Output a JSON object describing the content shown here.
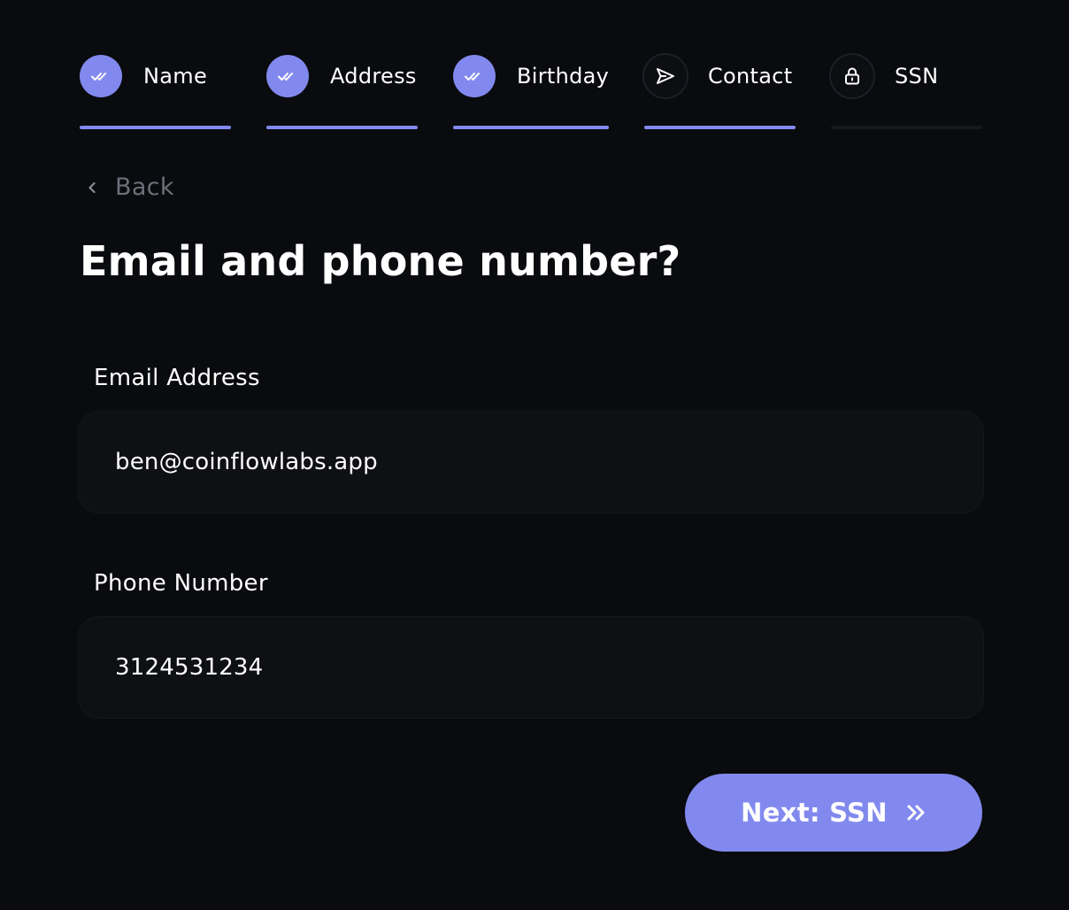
{
  "colors": {
    "background": "#0a0b0e",
    "accent": "#8289ee",
    "input_bg": "#0f1014",
    "muted_text": "#6d7079",
    "inactive_bar": "#16181e"
  },
  "stepper": {
    "steps": [
      {
        "label": "Name",
        "status": "completed",
        "icon": "double-check-icon"
      },
      {
        "label": "Address",
        "status": "completed",
        "icon": "double-check-icon"
      },
      {
        "label": "Birthday",
        "status": "completed",
        "icon": "double-check-icon"
      },
      {
        "label": "Contact",
        "status": "current",
        "icon": "send-icon"
      },
      {
        "label": "SSN",
        "status": "locked",
        "icon": "lock-icon"
      }
    ]
  },
  "back": {
    "label": "Back",
    "icon": "chevron-left-icon"
  },
  "title": "Email and phone number?",
  "form": {
    "email": {
      "label": "Email Address",
      "value": "ben@coinflowlabs.app"
    },
    "phone": {
      "label": "Phone Number",
      "value": "3124531234"
    }
  },
  "next_button": {
    "label": "Next: SSN",
    "icon": "chevrons-right-icon"
  }
}
